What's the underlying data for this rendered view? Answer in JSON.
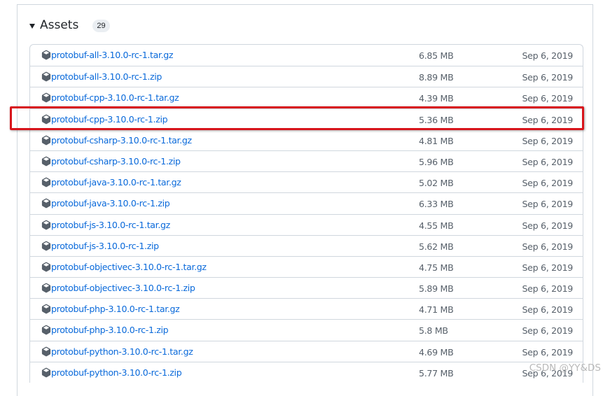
{
  "assets": {
    "title": "Assets",
    "count": "29",
    "items": [
      {
        "name": "protobuf-all-3.10.0-rc-1.tar.gz",
        "size": "6.85 MB",
        "date": "Sep 6, 2019"
      },
      {
        "name": "protobuf-all-3.10.0-rc-1.zip",
        "size": "8.89 MB",
        "date": "Sep 6, 2019"
      },
      {
        "name": "protobuf-cpp-3.10.0-rc-1.tar.gz",
        "size": "4.39 MB",
        "date": "Sep 6, 2019"
      },
      {
        "name": "protobuf-cpp-3.10.0-rc-1.zip",
        "size": "5.36 MB",
        "date": "Sep 6, 2019"
      },
      {
        "name": "protobuf-csharp-3.10.0-rc-1.tar.gz",
        "size": "4.81 MB",
        "date": "Sep 6, 2019"
      },
      {
        "name": "protobuf-csharp-3.10.0-rc-1.zip",
        "size": "5.96 MB",
        "date": "Sep 6, 2019"
      },
      {
        "name": "protobuf-java-3.10.0-rc-1.tar.gz",
        "size": "5.02 MB",
        "date": "Sep 6, 2019"
      },
      {
        "name": "protobuf-java-3.10.0-rc-1.zip",
        "size": "6.33 MB",
        "date": "Sep 6, 2019"
      },
      {
        "name": "protobuf-js-3.10.0-rc-1.tar.gz",
        "size": "4.55 MB",
        "date": "Sep 6, 2019"
      },
      {
        "name": "protobuf-js-3.10.0-rc-1.zip",
        "size": "5.62 MB",
        "date": "Sep 6, 2019"
      },
      {
        "name": "protobuf-objectivec-3.10.0-rc-1.tar.gz",
        "size": "4.75 MB",
        "date": "Sep 6, 2019"
      },
      {
        "name": "protobuf-objectivec-3.10.0-rc-1.zip",
        "size": "5.89 MB",
        "date": "Sep 6, 2019"
      },
      {
        "name": "protobuf-php-3.10.0-rc-1.tar.gz",
        "size": "4.71 MB",
        "date": "Sep 6, 2019"
      },
      {
        "name": "protobuf-php-3.10.0-rc-1.zip",
        "size": "5.8 MB",
        "date": "Sep 6, 2019"
      },
      {
        "name": "protobuf-python-3.10.0-rc-1.tar.gz",
        "size": "4.69 MB",
        "date": "Sep 6, 2019"
      },
      {
        "name": "protobuf-python-3.10.0-rc-1.zip",
        "size": "5.77 MB",
        "date": "Sep 6, 2019"
      }
    ]
  },
  "watermark": "CSDN @YY&DS",
  "colors": {
    "link": "#0969da",
    "muted": "#57606a",
    "border": "#d0d7de",
    "highlight": "#d8141b"
  },
  "icons": {
    "package": "package-icon",
    "caret": "caret-down-icon"
  }
}
